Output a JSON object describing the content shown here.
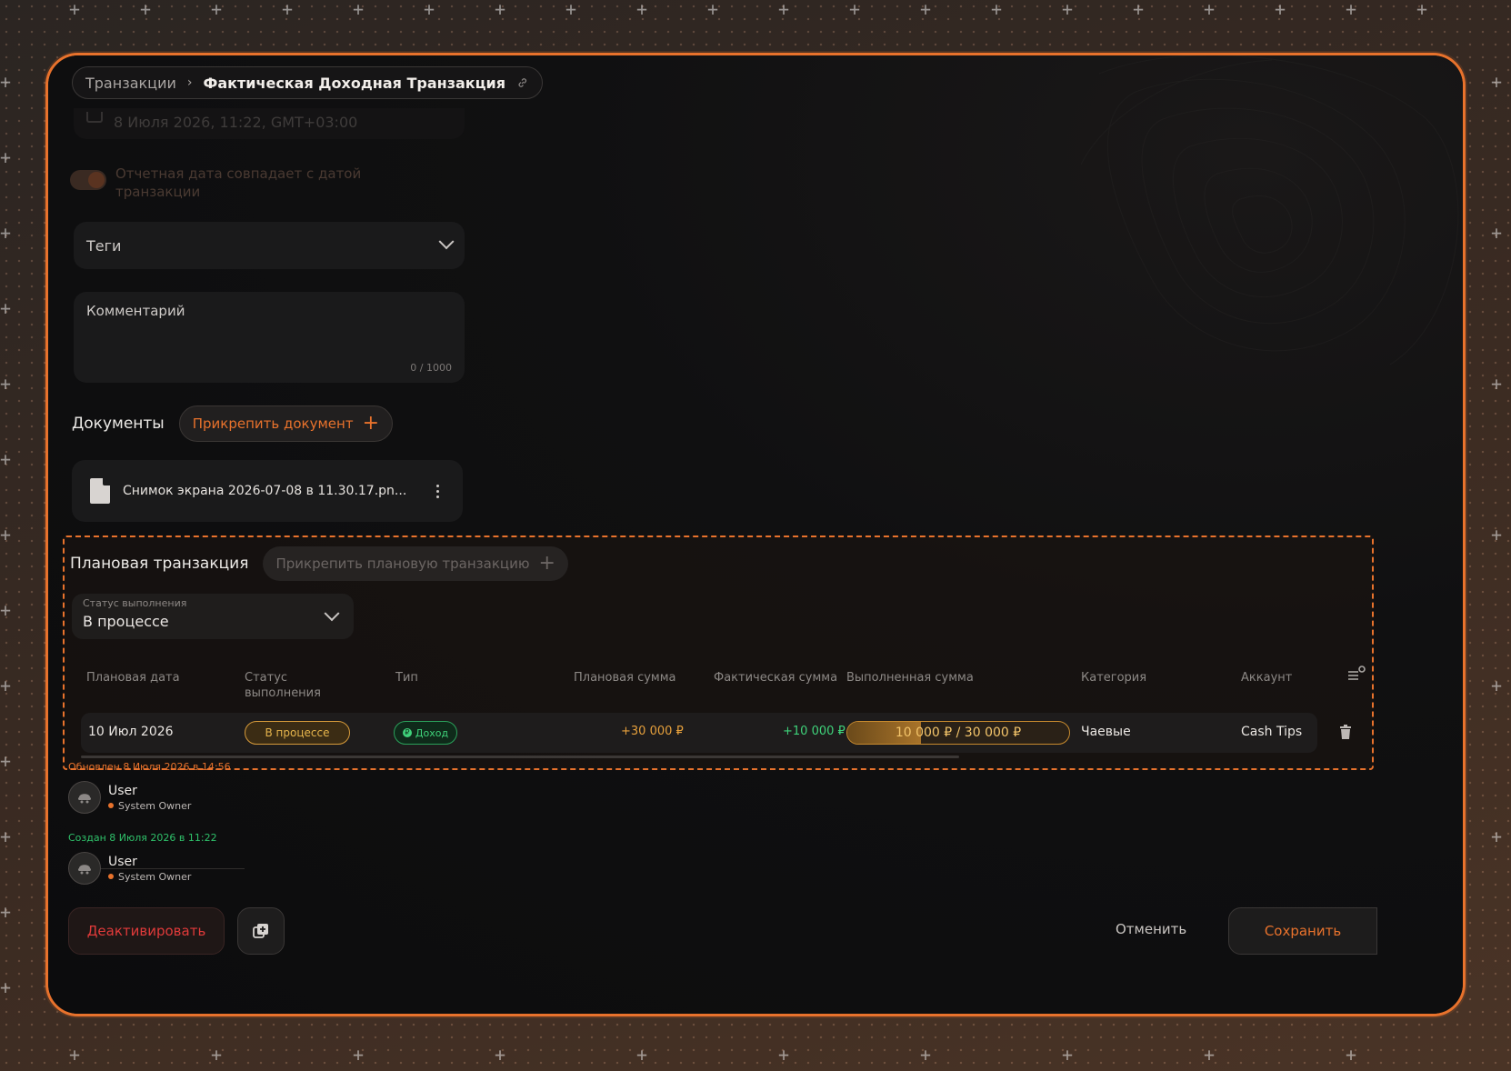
{
  "breadcrumb": {
    "parent": "Транзакции",
    "current": "Фактическая Доходная Транзакция"
  },
  "faded_date": "8 Июля 2026, 11:22, GMT+03:00",
  "report_toggle_label": "Отчетная дата совпадает с датой транзакции",
  "tags": {
    "placeholder": "Теги"
  },
  "comment": {
    "placeholder": "Комментарий",
    "counter": "0 / 1000"
  },
  "documents": {
    "title": "Документы",
    "attach_label": "Прикрепить документ",
    "file_name": "Снимок экрана 2026-07-08 в 11.30.17.pn..."
  },
  "planned": {
    "title": "Плановая транзакция",
    "attach_label": "Прикрепить плановую транзакцию",
    "status_filter": {
      "label": "Статус выполнения",
      "value": "В процессе"
    },
    "columns": {
      "plan_date": "Плановая дата",
      "status": "Статус выполнения",
      "type": "Тип",
      "plan_amount": "Плановая сумма",
      "fact_amount": "Фактическая сумма",
      "done_amount": "Выполненная сумма",
      "category": "Категория",
      "account": "Аккаунт"
    },
    "row": {
      "plan_date": "10 Июл 2026",
      "status": "В процессе",
      "type": "Доход",
      "plan_amount": "+30 000 ₽",
      "fact_amount": "+10 000 ₽",
      "done_amount": "10 000 ₽ / 30 000 ₽",
      "progress": 0.333,
      "category": "Чаевые",
      "account": "Cash Tips"
    }
  },
  "audit": {
    "updated": "Обновлен 8 Июля 2026 в 14:56",
    "created": "Создан 8 Июля 2026 в 11:22",
    "user_name": "User",
    "user_role": "System Owner"
  },
  "actions": {
    "deactivate": "Деактивировать",
    "cancel": "Отменить",
    "save": "Сохранить"
  },
  "colors": {
    "accent": "#e8722c",
    "success": "#3fd27a",
    "warning": "#e6b44c",
    "danger": "#e03a3a"
  }
}
